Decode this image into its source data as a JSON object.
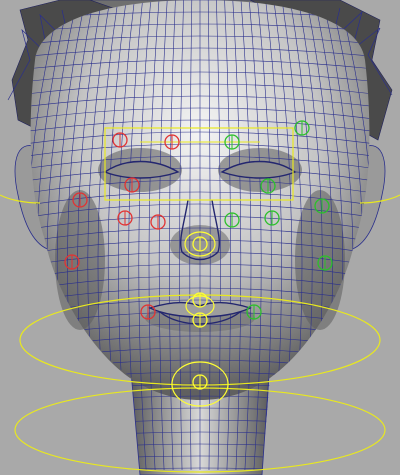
{
  "viewport": {
    "background": "#a9a9a9",
    "subject": "head-mesh",
    "mesh_color": "#2a2f8c",
    "skin_color": "#d7d7d7",
    "hair_color": "#444444",
    "rig_colors": {
      "left": "#e23232",
      "right": "#2bc02b",
      "center": "#ffff33",
      "selection": "#e8e820"
    }
  },
  "rig": {
    "left_controls": [
      "brow-l-outer",
      "brow-l-inner",
      "eye-l-outer",
      "eye-l-upper",
      "cheek-l",
      "nostril-l",
      "mouth-corner-l",
      "jaw-l"
    ],
    "right_controls": [
      "brow-r-outer",
      "brow-r-inner",
      "eye-r-outer",
      "eye-r-upper",
      "cheek-r",
      "nostril-r",
      "mouth-corner-r",
      "jaw-r"
    ],
    "center_controls": [
      "nose-tip",
      "lip-upper",
      "lip-lower",
      "chin"
    ]
  }
}
